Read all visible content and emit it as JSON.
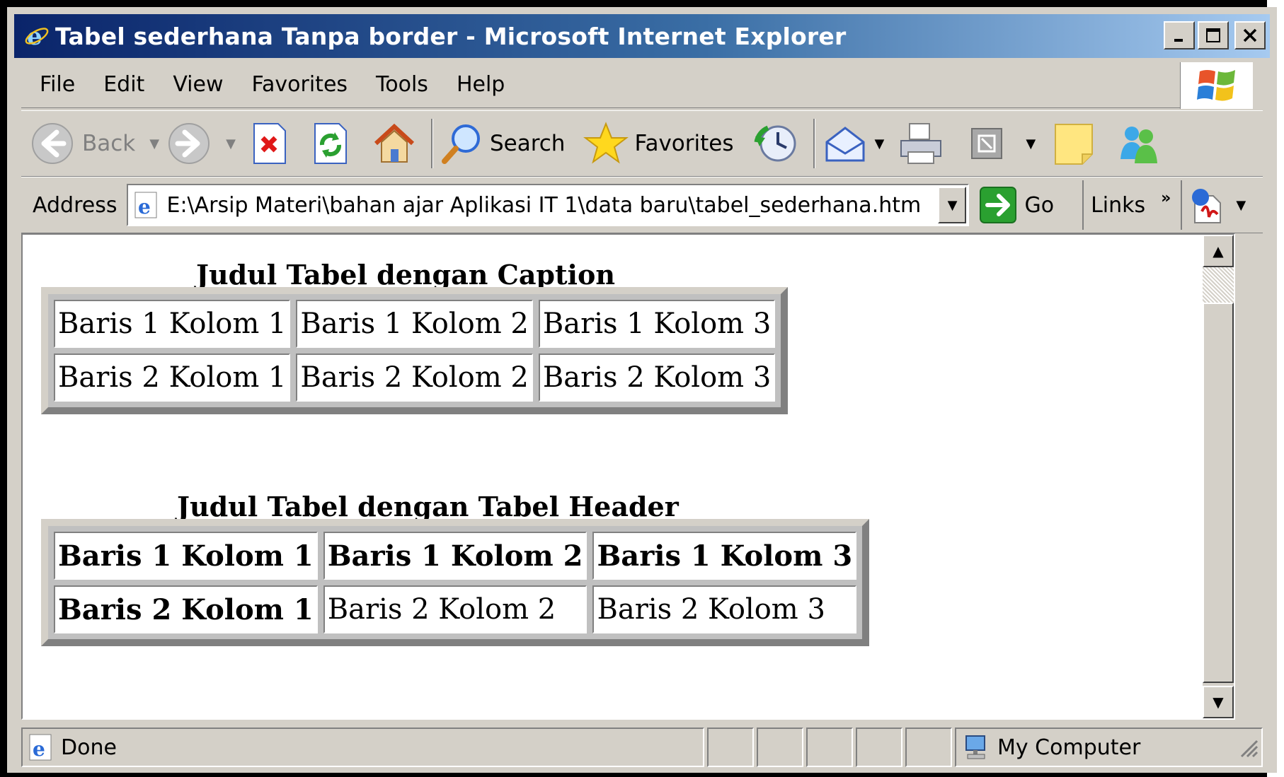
{
  "window": {
    "title": "Tabel sederhana Tanpa border - Microsoft Internet Explorer"
  },
  "menu": [
    "File",
    "Edit",
    "View",
    "Favorites",
    "Tools",
    "Help"
  ],
  "toolbar": {
    "back": "Back",
    "search": "Search",
    "favorites": "Favorites"
  },
  "address": {
    "label": "Address",
    "url": "E:\\Arsip Materi\\bahan ajar Aplikasi IT 1\\data baru\\tabel_sederhana.htm",
    "go": "Go",
    "links": "Links",
    "links_more": "»"
  },
  "page": {
    "caption1": "Judul Tabel dengan Caption",
    "table1": [
      [
        "Baris 1 Kolom 1",
        "Baris 1 Kolom 2",
        "Baris 1 Kolom 3"
      ],
      [
        "Baris 2 Kolom 1",
        "Baris 2 Kolom 2",
        "Baris 2 Kolom 3"
      ]
    ],
    "caption2": "Judul Tabel dengan Tabel Header",
    "table2": [
      [
        "Baris 1 Kolom 1",
        "Baris 1 Kolom 2",
        "Baris 1 Kolom 3"
      ],
      [
        "Baris 2 Kolom 1",
        "Baris 2 Kolom 2",
        "Baris 2 Kolom 3"
      ]
    ]
  },
  "status": {
    "text": "Done",
    "zone": "My Computer"
  }
}
